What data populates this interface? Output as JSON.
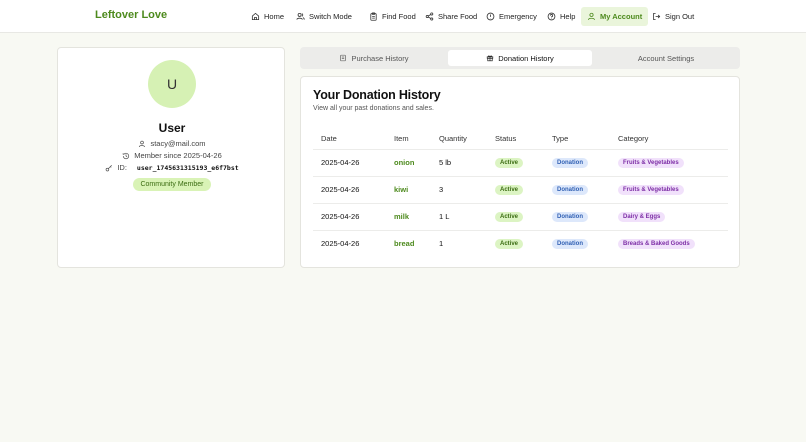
{
  "brand": "Leftover Love",
  "nav": {
    "home": "Home",
    "switch_mode": "Switch Mode",
    "find_food": "Find Food",
    "share_food": "Share Food",
    "emergency": "Emergency",
    "help": "Help",
    "my_account": "My Account",
    "sign_out": "Sign Out"
  },
  "profile": {
    "avatar_initial": "U",
    "name": "User",
    "email": "stacy@mail.com",
    "member_since": "Member since 2025-04-26",
    "id_label": "ID:",
    "id_value": "user_1745631315193_e6f7bst",
    "badge": "Community Member"
  },
  "tabs": {
    "purchase": "Purchase History",
    "donation": "Donation History",
    "settings": "Account Settings"
  },
  "donations": {
    "title": "Your Donation History",
    "subtitle": "View all your past donations and sales.",
    "columns": [
      "Date",
      "Item",
      "Quantity",
      "Status",
      "Type",
      "Category"
    ],
    "rows": [
      {
        "date": "2025-04-26",
        "item": "onion",
        "quantity": "5 lb",
        "status": "Active",
        "type": "Donation",
        "category": "Fruits & Vegetables"
      },
      {
        "date": "2025-04-26",
        "item": "kiwi",
        "quantity": "3",
        "status": "Active",
        "type": "Donation",
        "category": "Fruits & Vegetables"
      },
      {
        "date": "2025-04-26",
        "item": "milk",
        "quantity": "1 L",
        "status": "Active",
        "type": "Donation",
        "category": "Dairy & Eggs"
      },
      {
        "date": "2025-04-26",
        "item": "bread",
        "quantity": "1",
        "status": "Active",
        "type": "Donation",
        "category": "Breads & Baked Goods"
      }
    ]
  },
  "colors": {
    "brand_green": "#4d8a1d",
    "active_nav_bg": "#eaf5db",
    "status_pill": "#dcf4c3",
    "type_pill": "#dde8fb",
    "category_pill": "#f1e1fb"
  }
}
